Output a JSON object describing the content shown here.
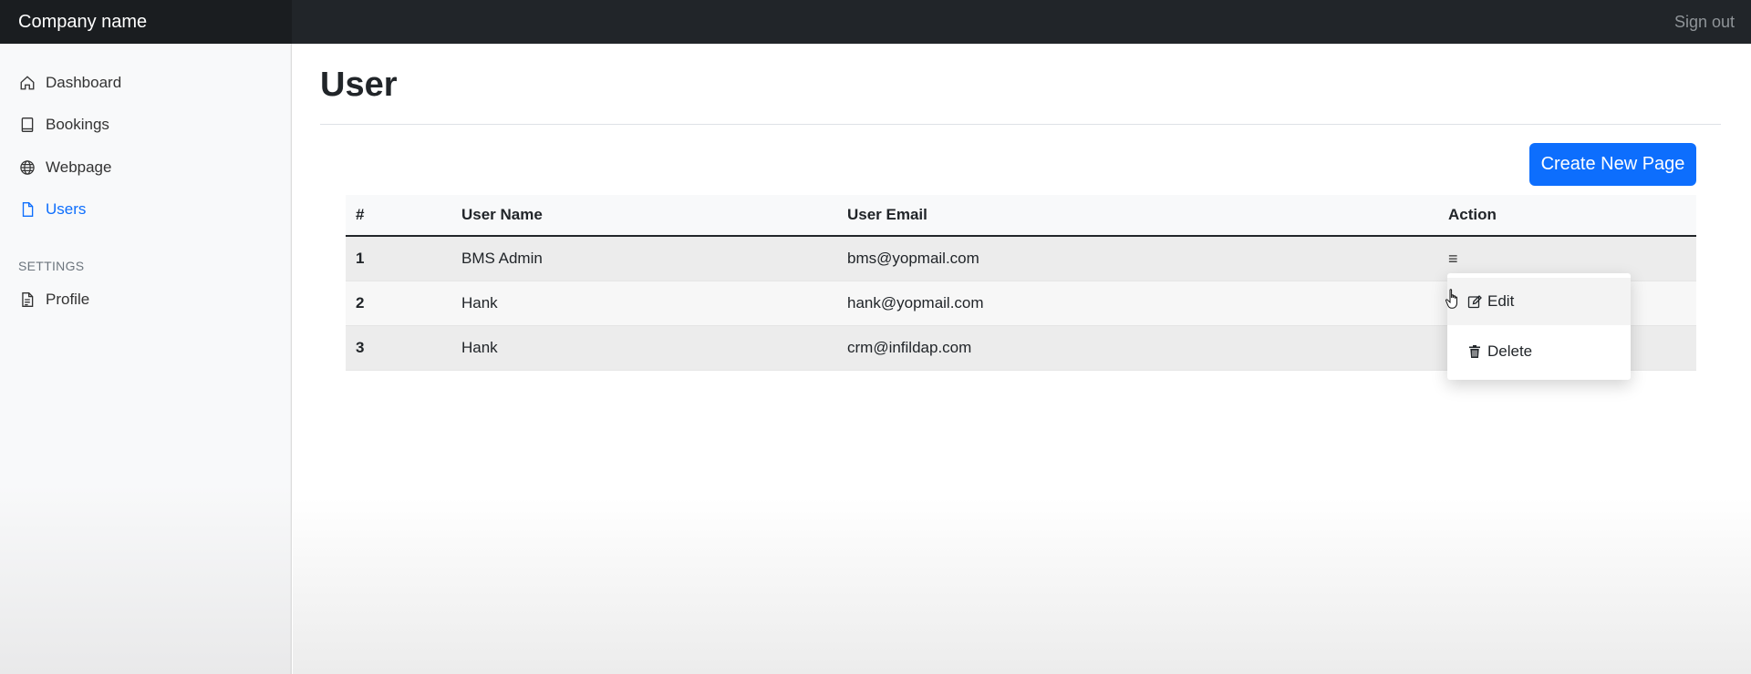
{
  "topbar": {
    "brand": "Company name",
    "signout": "Sign out"
  },
  "sidebar": {
    "items": [
      {
        "label": "Dashboard",
        "icon": "home-icon"
      },
      {
        "label": "Bookings",
        "icon": "book-icon"
      },
      {
        "label": "Webpage",
        "icon": "globe-icon"
      },
      {
        "label": "Users",
        "icon": "file-icon",
        "active": true
      }
    ],
    "settings_heading": "SETTINGS",
    "settings_items": [
      {
        "label": "Profile",
        "icon": "file-text-icon"
      }
    ]
  },
  "page": {
    "title": "User",
    "create_button": "Create New Page"
  },
  "table": {
    "headers": [
      "#",
      "User Name",
      "User Email",
      "Action"
    ],
    "rows": [
      {
        "num": "1",
        "name": "BMS Admin",
        "email": "bms@yopmail.com"
      },
      {
        "num": "2",
        "name": "Hank",
        "email": "hank@yopmail.com"
      },
      {
        "num": "3",
        "name": "Hank",
        "email": "crm@infildap.com"
      }
    ],
    "action_trigger": "≡"
  },
  "dropdown": {
    "edit_label": "Edit",
    "delete_label": "Delete"
  },
  "colors": {
    "primary": "#0d6efd",
    "topbar": "#212529"
  }
}
